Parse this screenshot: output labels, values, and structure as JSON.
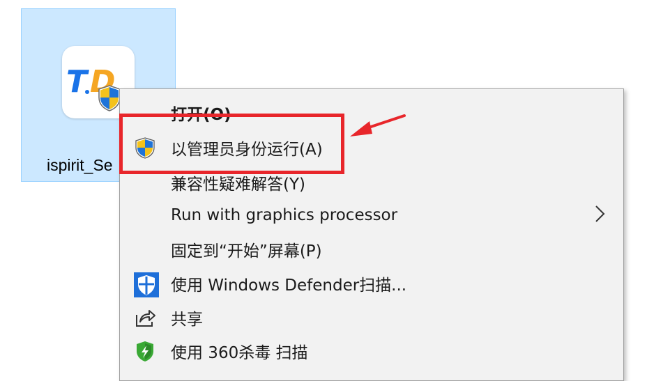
{
  "desktop_icon": {
    "label": "ispirit_Se",
    "logo_text": "TD"
  },
  "context_menu": {
    "items": [
      {
        "label": "打开(O)",
        "icon": "none"
      },
      {
        "label": "以管理员身份运行(A)",
        "icon": "uac-shield-icon"
      },
      {
        "label": "兼容性疑难解答(Y)",
        "icon": "none"
      },
      {
        "label": "Run with graphics processor",
        "icon": "none",
        "submenu": true
      },
      {
        "label": "固定到“开始”屏幕(P)",
        "icon": "none"
      },
      {
        "label": "使用 Windows Defender扫描...",
        "icon": "windows-defender-icon"
      },
      {
        "label": "共享",
        "icon": "share-icon"
      },
      {
        "label": "使用 360杀毒 扫描",
        "icon": "360-antivirus-icon"
      }
    ]
  },
  "colors": {
    "selection": "#cce8ff",
    "highlight": "#e8262b",
    "menu_bg": "#f2f2f2",
    "defender_blue": "#1e6fd9",
    "logo_blue": "#1a73e8",
    "logo_orange": "#f5a623"
  }
}
